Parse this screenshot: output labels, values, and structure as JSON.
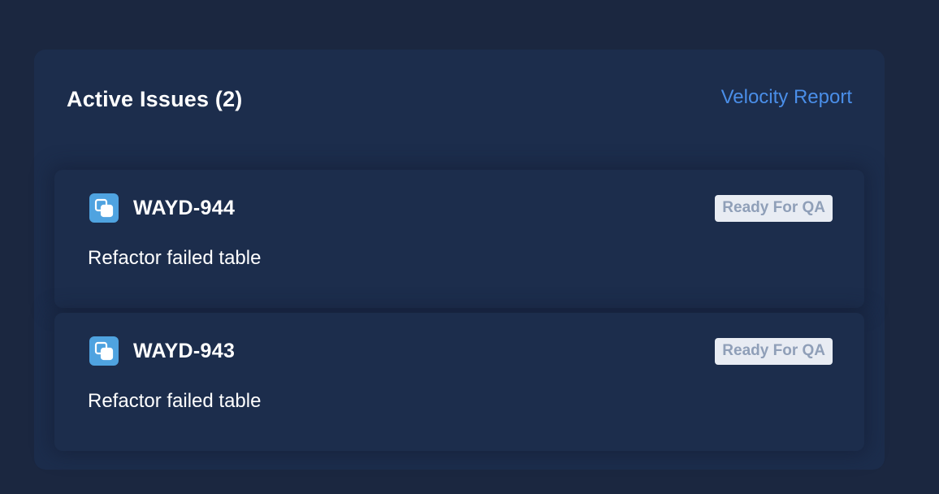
{
  "panel": {
    "title": "Active Issues (2)",
    "report_link": "Velocity Report"
  },
  "issues": [
    {
      "key": "WAYD-944",
      "status": "Ready For QA",
      "summary": "Refactor failed table",
      "icon": "subtask-icon"
    },
    {
      "key": "WAYD-943",
      "status": "Ready For QA",
      "summary": "Refactor failed table",
      "icon": "subtask-icon"
    }
  ],
  "colors": {
    "page_bg": "#1b2740",
    "card_bg": "#1c2d4c",
    "link": "#4a8ee8",
    "icon_bg": "#4fa3e0",
    "badge_bg": "#e8ecf3",
    "badge_text": "#8f9fb8"
  }
}
